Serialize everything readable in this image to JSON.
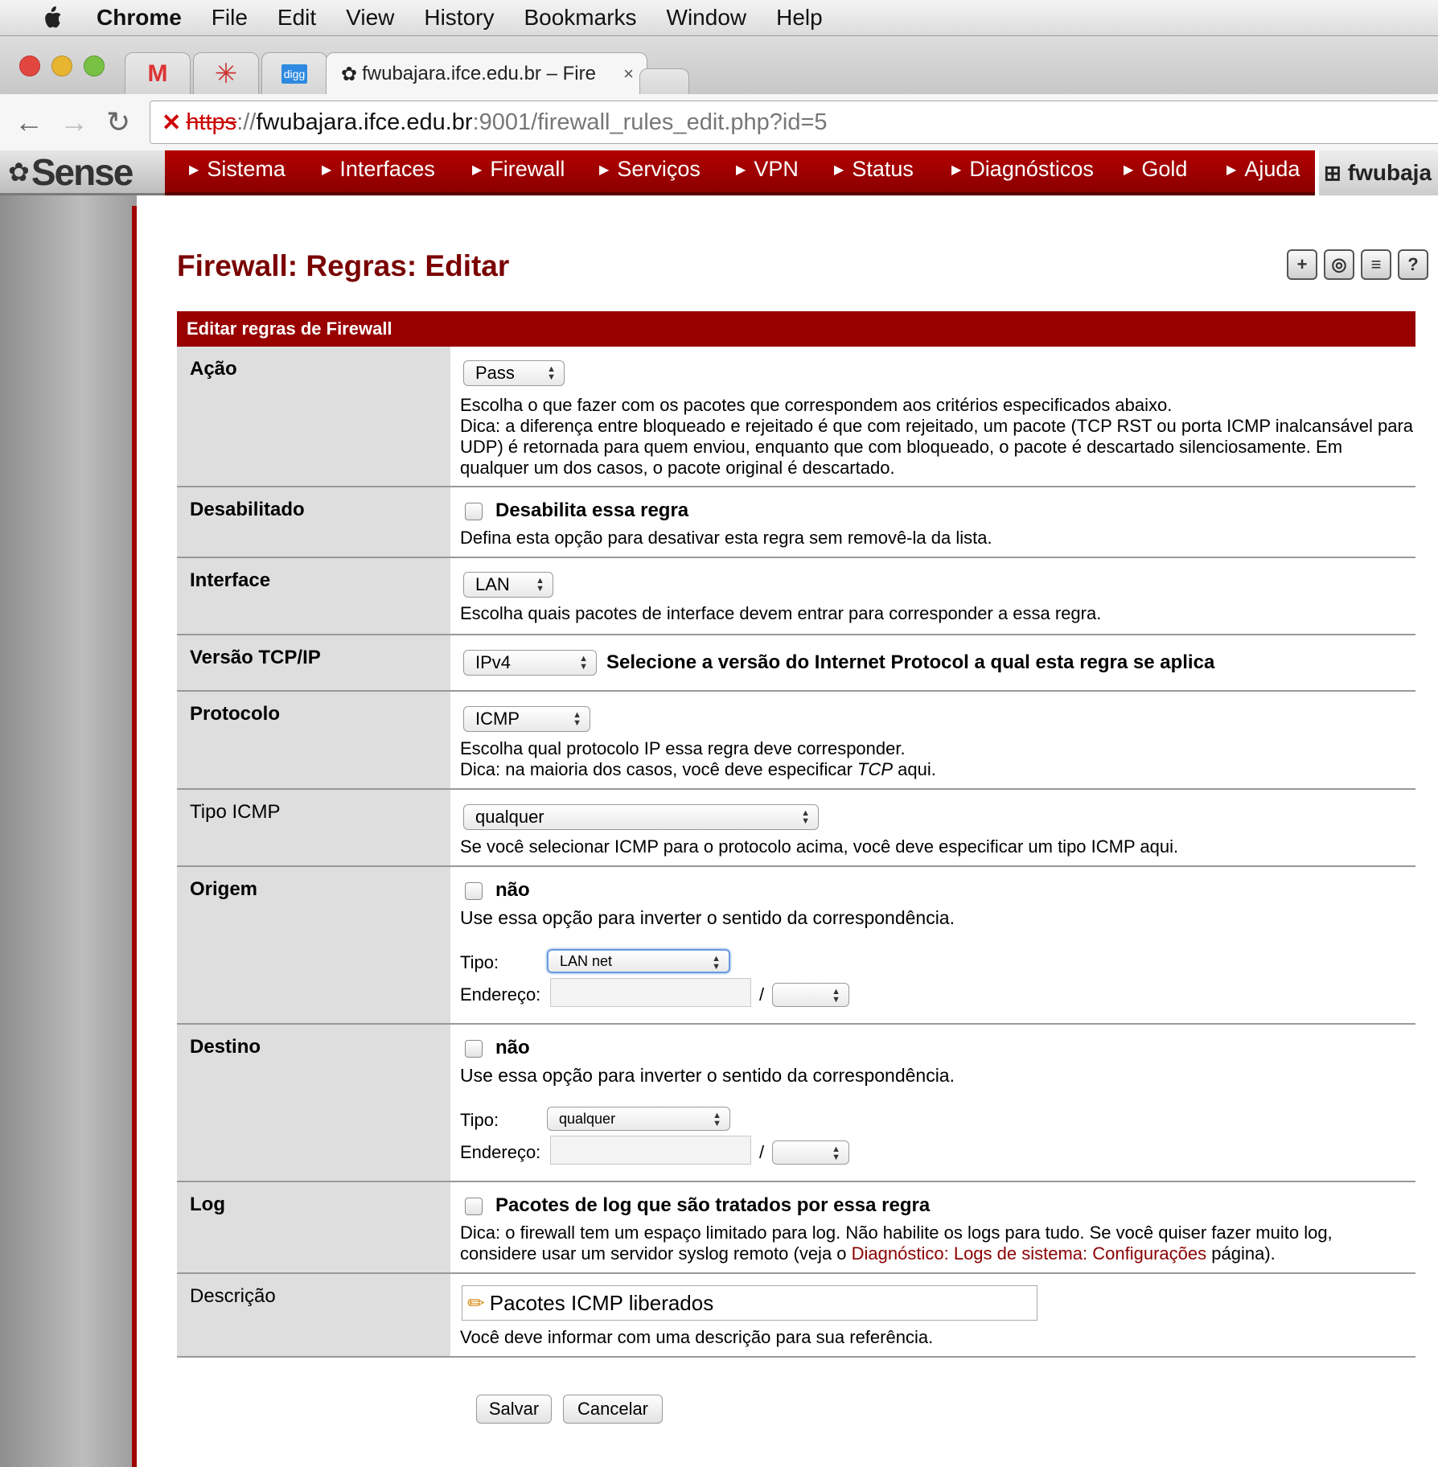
{
  "menubar": {
    "app": "Chrome",
    "items": [
      "File",
      "Edit",
      "View",
      "History",
      "Bookmarks",
      "Window",
      "Help"
    ]
  },
  "browser": {
    "active_tab_title": "fwubajara.ifce.edu.br – Fire",
    "tab_close": "×",
    "url": {
      "scheme": "https",
      "separator": "://",
      "host": "fwubajara.ifce.edu.br",
      "rest": ":9001/firewall_rules_edit.php?id=5"
    },
    "digg_label": "digg"
  },
  "header": {
    "logo": "Sense",
    "nav": [
      "Sistema",
      "Interfaces",
      "Firewall",
      "Serviços",
      "VPN",
      "Status",
      "Diagnósticos",
      "Gold",
      "Ajuda"
    ],
    "hostname": "fwubaja"
  },
  "page": {
    "title": "Firewall: Regras: Editar",
    "form_header": "Editar regras de Firewall",
    "colors": {
      "accent": "#990000",
      "title": "#7a0000"
    }
  },
  "form": {
    "acao": {
      "label": "Ação",
      "value": "Pass",
      "help1": "Escolha o que fazer com os pacotes que correspondem aos critérios especificados abaixo.",
      "help2": "Dica: a diferença entre bloqueado e rejeitado é que com rejeitado, um pacote (TCP RST ou porta ICMP inalcansável para",
      "help3": "UDP) é retornada para quem enviou, enquanto que com bloqueado, o pacote é descartado silenciosamente. Em",
      "help4": "qualquer um dos casos, o pacote original é descartado."
    },
    "desabilitado": {
      "label": "Desabilitado",
      "checkbox_label": "Desabilita essa regra",
      "help": "Defina esta opção para desativar esta regra sem removê-la da lista."
    },
    "interface": {
      "label": "Interface",
      "value": "LAN",
      "help": "Escolha quais pacotes de interface devem entrar para corresponder a essa regra."
    },
    "versao": {
      "label": "Versão TCP/IP",
      "value": "IPv4",
      "help": "Selecione a versão do Internet Protocol a qual esta regra se aplica"
    },
    "protocolo": {
      "label": "Protocolo",
      "value": "ICMP",
      "help1": "Escolha qual protocolo IP essa regra deve corresponder.",
      "help2_pre": "Dica: na maioria dos casos, você deve especificar",
      "help2_em": "TCP",
      "help2_post": "aqui."
    },
    "tipo_icmp": {
      "label": "Tipo ICMP",
      "value": "qualquer",
      "help": "Se você selecionar ICMP para o protocolo acima, você deve especificar um tipo ICMP aqui."
    },
    "origem": {
      "label": "Origem",
      "not_label": "não",
      "help": "Use essa opção para inverter o sentido da correspondência.",
      "tipo_label": "Tipo:",
      "tipo_value": "LAN net",
      "endereco_label": "Endereço:",
      "slash": "/"
    },
    "destino": {
      "label": "Destino",
      "not_label": "não",
      "help": "Use essa opção para inverter o sentido da correspondência.",
      "tipo_label": "Tipo:",
      "tipo_value": "qualquer",
      "endereco_label": "Endereço:",
      "slash": "/"
    },
    "log": {
      "label": "Log",
      "checkbox_label": "Pacotes de log que são tratados por essa regra",
      "help1": "Dica: o firewall tem um espaço limitado para log. Não habilite os logs para tudo. Se você quiser fazer muito log,",
      "help2_pre": "considere usar um servidor syslog remoto (veja o",
      "help2_link": "Diagnóstico: Logs de sistema: Configurações",
      "help2_post": "página)."
    },
    "descricao": {
      "label": "Descrição",
      "value": "Pacotes ICMP liberados",
      "help": "Você deve informar com uma descrição para sua referência."
    }
  },
  "buttons": {
    "save": "Salvar",
    "cancel": "Cancelar"
  }
}
